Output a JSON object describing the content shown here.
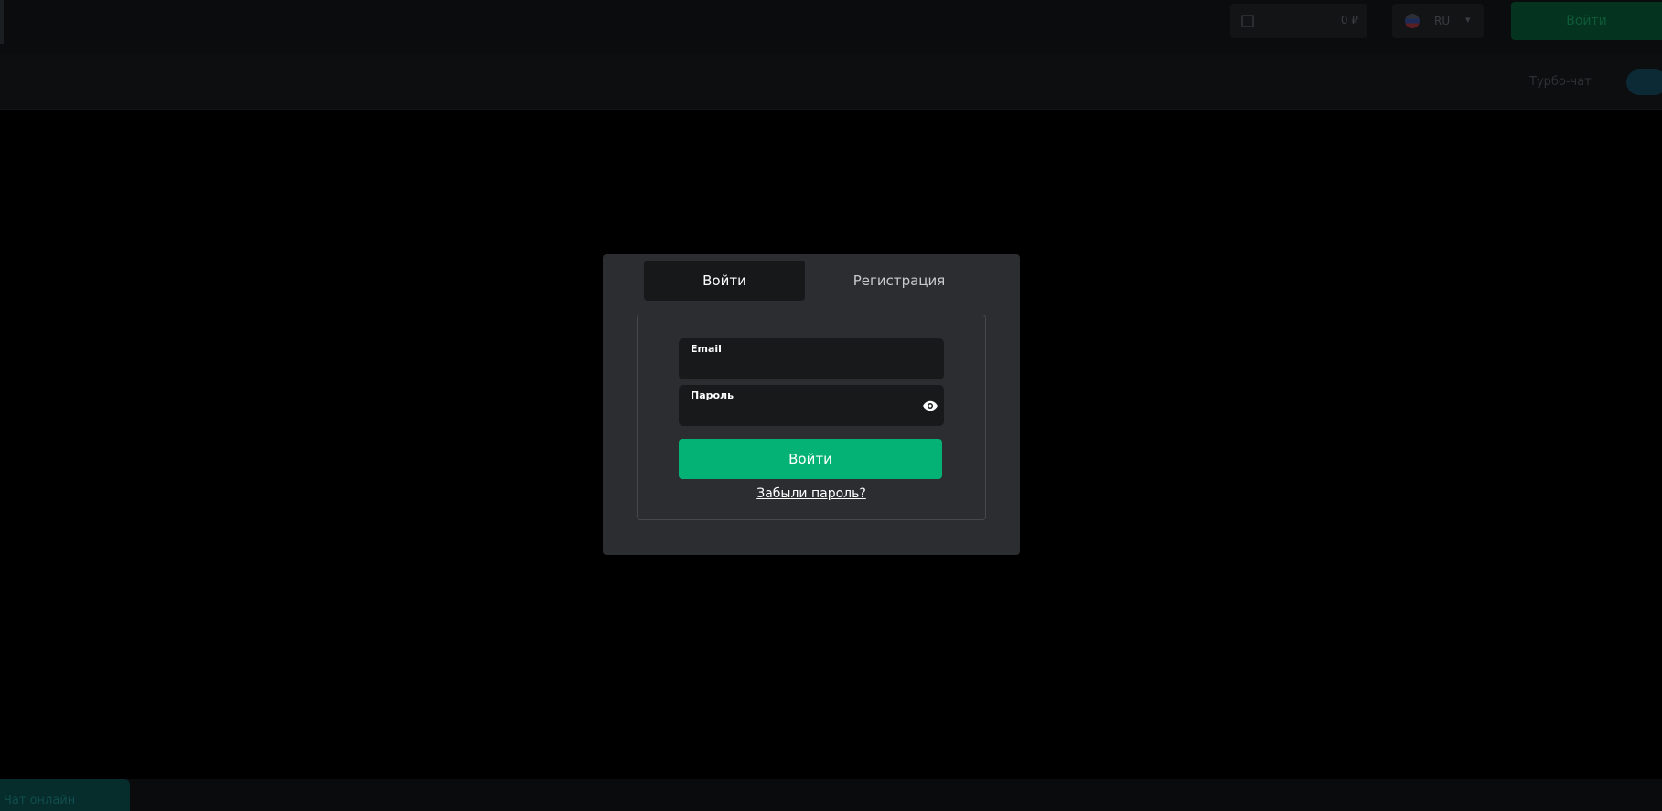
{
  "backdrop": {
    "balance_value": "0 ₽",
    "lang_code": "RU",
    "top_login_label": "Войти",
    "subbar_text": "Турбо-чат",
    "bottom_chat_label": "Чат онлайн"
  },
  "modal": {
    "tabs": [
      {
        "label": "Войти",
        "active": true
      },
      {
        "label": "Регистрация",
        "active": false
      }
    ],
    "email": {
      "label": "Email",
      "value": ""
    },
    "password": {
      "label": "Пароль",
      "value": ""
    },
    "submit_label": "Войти",
    "forgot_label": "Забыли пароль?"
  },
  "colors": {
    "accent": "#04b275",
    "modal_bg": "#2c2d31",
    "field_bg": "#18191a"
  },
  "icons": {
    "password_toggle": "eye-icon"
  }
}
